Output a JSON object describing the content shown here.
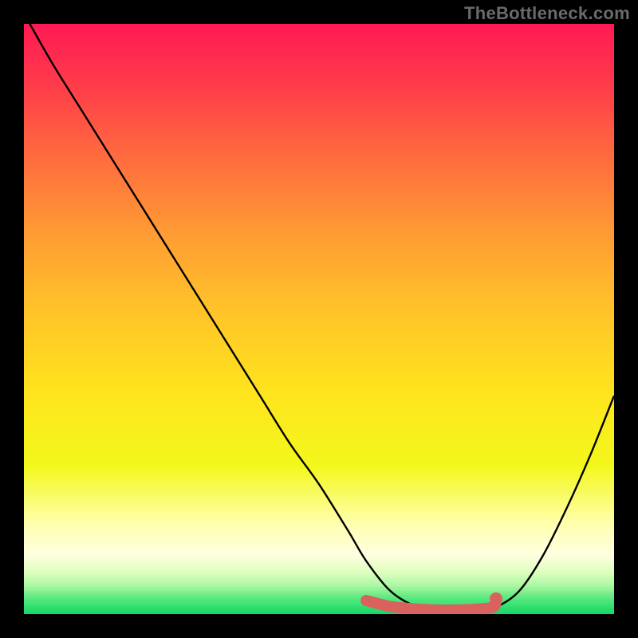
{
  "attribution": "TheBottleneck.com",
  "chart_data": {
    "type": "line",
    "title": "",
    "xlabel": "",
    "ylabel": "",
    "xlim": [
      0,
      100
    ],
    "ylim": [
      0,
      100
    ],
    "grid": false,
    "legend": false,
    "series": [
      {
        "name": "bottleneck-curve",
        "color": "#000000",
        "x": [
          1,
          5,
          10,
          15,
          20,
          25,
          30,
          35,
          40,
          45,
          50,
          55,
          58,
          62,
          66,
          70,
          73,
          76,
          80,
          84,
          88,
          92,
          96,
          100
        ],
        "y": [
          100,
          93,
          85,
          77,
          69,
          61,
          53,
          45,
          37,
          29,
          22,
          14,
          9,
          4,
          1.5,
          0.8,
          0.6,
          0.6,
          1.2,
          4,
          10,
          18,
          27,
          37
        ]
      },
      {
        "name": "optimal-marker",
        "color": "#d9625f",
        "style": "thick-rounded",
        "x": [
          58,
          62,
          66,
          70,
          73,
          76,
          79.5,
          80
        ],
        "y": [
          2.3,
          1.3,
          0.9,
          0.7,
          0.7,
          0.8,
          1.2,
          2.6
        ]
      }
    ],
    "background_gradient": {
      "type": "vertical",
      "stops": [
        {
          "pos": 0.0,
          "color": "#ff1a54"
        },
        {
          "pos": 0.1,
          "color": "#ff3b4a"
        },
        {
          "pos": 0.22,
          "color": "#ff6a3f"
        },
        {
          "pos": 0.35,
          "color": "#ff9a34"
        },
        {
          "pos": 0.48,
          "color": "#ffc229"
        },
        {
          "pos": 0.62,
          "color": "#ffe31e"
        },
        {
          "pos": 0.75,
          "color": "#f3f81b"
        },
        {
          "pos": 0.85,
          "color": "#ffffb0"
        },
        {
          "pos": 0.9,
          "color": "#ffffe0"
        },
        {
          "pos": 0.93,
          "color": "#e0ffc0"
        },
        {
          "pos": 0.955,
          "color": "#a8f7a0"
        },
        {
          "pos": 0.975,
          "color": "#5ae87e"
        },
        {
          "pos": 1.0,
          "color": "#18d866"
        }
      ]
    }
  }
}
